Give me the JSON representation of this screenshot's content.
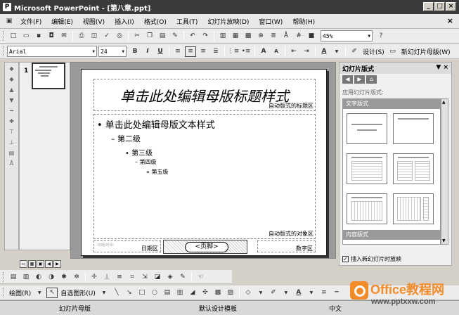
{
  "window": {
    "title": "Microsoft PowerPoint - [第八章.ppt]",
    "controls": [
      "_",
      "□",
      "×"
    ]
  },
  "menubar": {
    "items": [
      "文件(F)",
      "编辑(E)",
      "视图(V)",
      "插入(I)",
      "格式(O)",
      "工具(T)",
      "幻灯片放映(D)",
      "窗口(W)",
      "帮助(H)"
    ],
    "close": "×"
  },
  "standard_toolbar": {
    "zoom": "45%"
  },
  "format_toolbar": {
    "font": "Arial",
    "size": "24",
    "bold": "B",
    "italic": "I",
    "underline": "U",
    "increase_font": "A",
    "decrease_font": "A",
    "font_color": "A",
    "design": "设计(S)",
    "new_master": "新幻灯片母版(W)"
  },
  "thumbnails": {
    "slide_number": "1"
  },
  "slide": {
    "title": "单击此处编辑母版标题样式",
    "title_area_label": "自动版式的标题区",
    "body_level1": "• 单击此处编辑母版文本样式",
    "body_level2": "– 第二级",
    "body_level3": "• 第三级",
    "body_level4": "– 第四级",
    "body_level5": "» 第五级",
    "object_area_label": "自动版式的对象区",
    "date_label": "日期区",
    "footer_label": "<页脚>",
    "number_label": "数字区"
  },
  "task_pane": {
    "title": "幻灯片版式",
    "apply_label": "应用幻灯片版式:",
    "section_text": "文字版式",
    "section_content": "内容版式",
    "checkbox_label": "插入新幻灯片时放映",
    "checkbox_checked": true
  },
  "drawing_toolbar": {
    "draw": "绘图(R)",
    "autoshapes": "自选图形(U)"
  },
  "statusbar": {
    "view": "幻灯片母版",
    "design": "默认设计模板",
    "language": "中文"
  },
  "watermark": {
    "brand": "Office教程网",
    "url": "www.pptxxw.com"
  }
}
